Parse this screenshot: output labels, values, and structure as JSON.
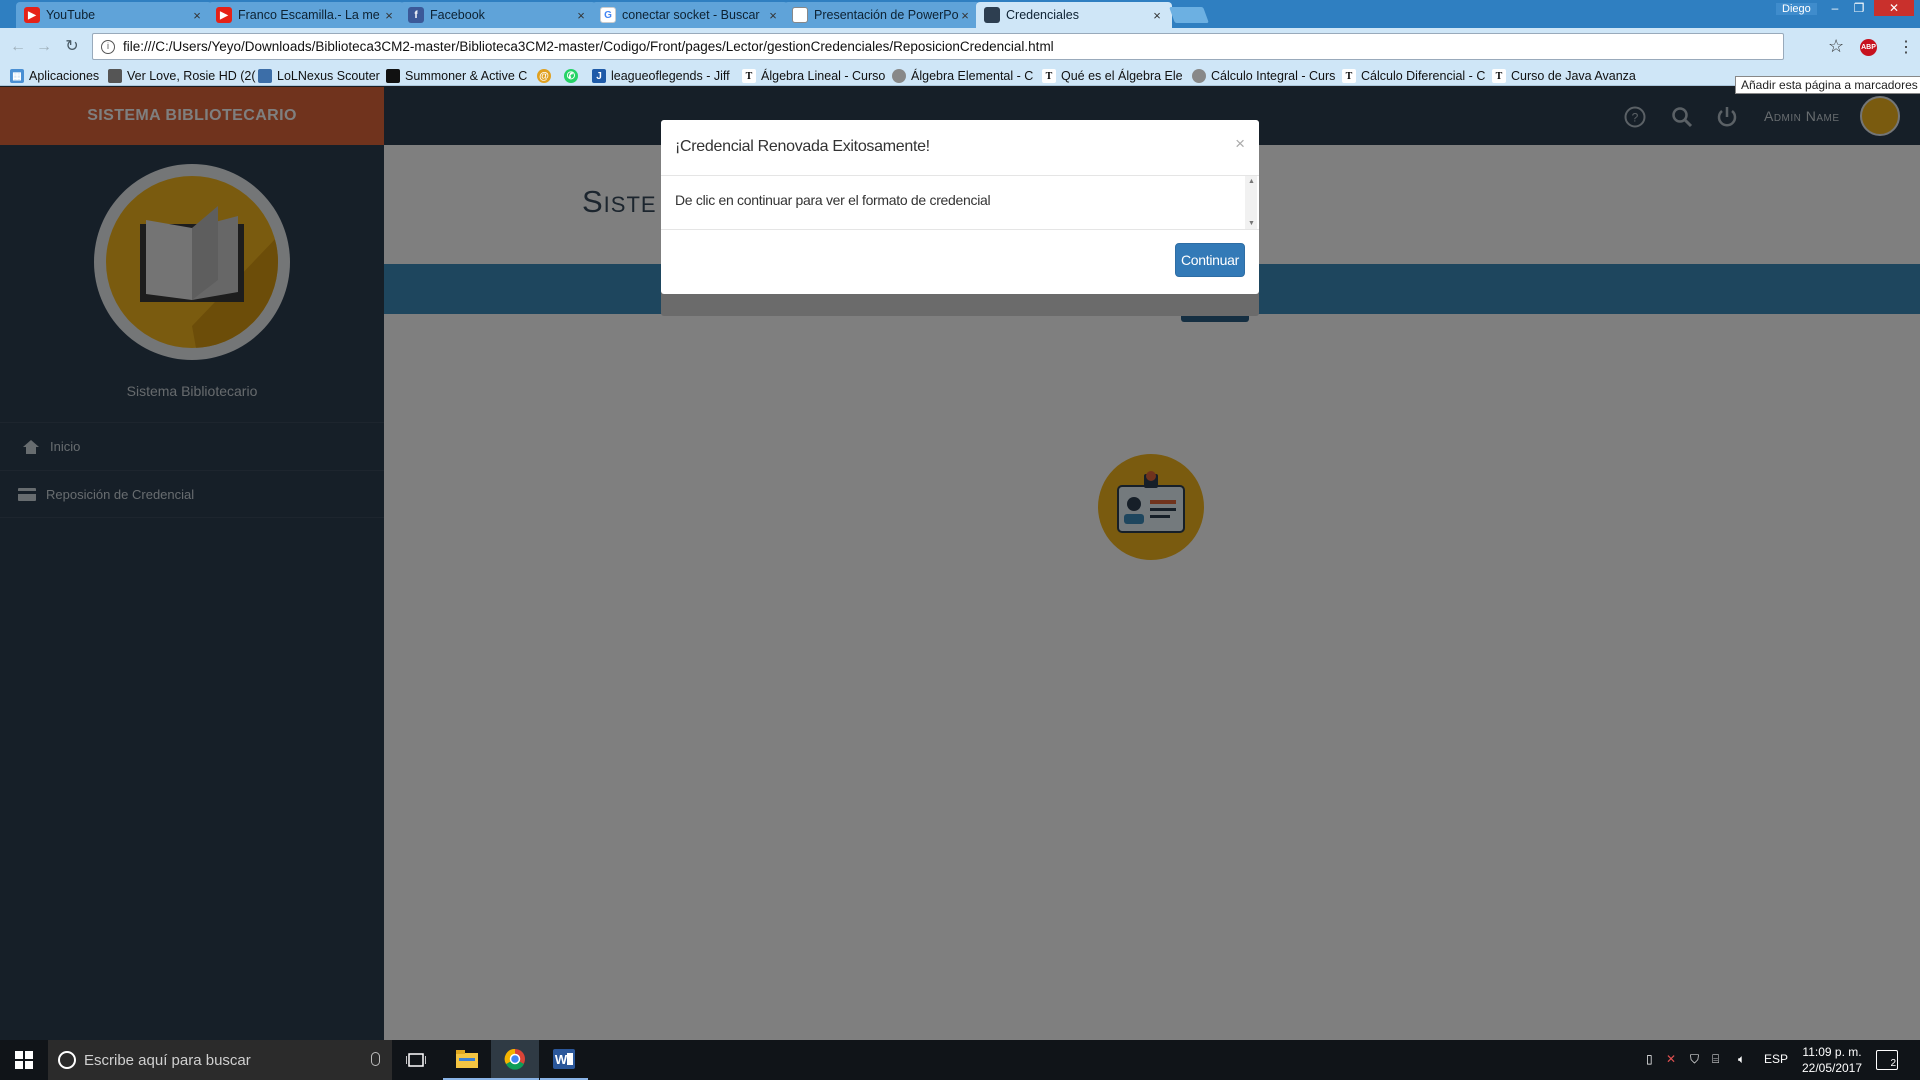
{
  "browser": {
    "tabs": [
      {
        "title": "YouTube",
        "favicon": "youtube-icon",
        "color": "#e62117"
      },
      {
        "title": "Franco Escamilla.- La me",
        "favicon": "youtube-icon",
        "color": "#e62117"
      },
      {
        "title": "Facebook",
        "favicon": "facebook-icon",
        "color": "#3b5998"
      },
      {
        "title": "conectar socket - Buscar",
        "favicon": "google-icon",
        "color": "#4285f4"
      },
      {
        "title": "Presentación de PowerPo",
        "favicon": "document-icon",
        "color": "#666666"
      },
      {
        "title": "Credenciales",
        "favicon": "page-icon",
        "color": "#2d3e50"
      }
    ],
    "window_user": "Diego",
    "url": "file:///C:/Users/Yeyo/Downloads/Biblioteca3CM2-master/Biblioteca3CM2-master/Codigo/Front/pages/Lector/gestionCredenciales/ReposicionCredencial.html",
    "abp_label": "ABP",
    "bookmarks": [
      "Aplicaciones",
      "Ver Love, Rosie HD (2(",
      "LoLNexus Scouter",
      "Summoner & Active C",
      "",
      "",
      "leagueoflegends - Jiff",
      "Álgebra Lineal - Curso",
      "Álgebra Elemental - C",
      "Qué es el Álgebra Ele",
      "Cálculo Integral - Curs",
      "Cálculo Diferencial - C",
      "Curso de Java Avanza"
    ],
    "bookmark_tooltip": "Añadir esta página a marcadores"
  },
  "app": {
    "brand": "SISTEMA BIBLIOTECARIO",
    "sidebar_name": "Sistema Bibliotecario",
    "menu": [
      {
        "label": "Inicio",
        "icon": "home-icon"
      },
      {
        "label": "Reposición de Credencial",
        "icon": "credit-card-icon"
      }
    ],
    "admin_name": "Admin Name",
    "page_title": "Siste",
    "colors": {
      "brand": "#e0663b",
      "sidebar": "#2d3e50",
      "accent": "#3c8dbc",
      "logo": "#f5b71f",
      "primary_button": "#337ab7"
    }
  },
  "modal": {
    "title": "¡Credencial Renovada Exitosamente!",
    "close": "×",
    "body": "De clic en continuar para ver el formato de credencial",
    "button": "Continuar"
  },
  "taskbar": {
    "search_placeholder": "Escribe aquí para buscar",
    "lang": "ESP",
    "time": "11:09 p. m.",
    "date": "22/05/2017",
    "notifications": "2"
  }
}
